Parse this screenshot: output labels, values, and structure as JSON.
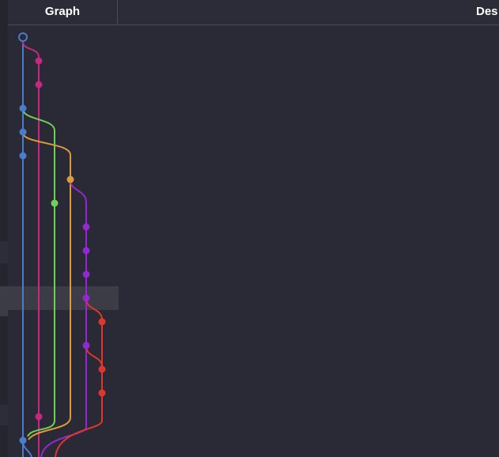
{
  "header": {
    "graph_label": "Graph",
    "description_label": "Des"
  },
  "colors": {
    "background": "#292a35",
    "header_background": "#2b2c37",
    "selection": "#3b3c46",
    "branch_blue": "#4a7cc9",
    "branch_magenta": "#c4287f",
    "branch_green": "#6dd155",
    "branch_orange": "#dc9a3b",
    "branch_purple": "#9029d0",
    "branch_red": "#e0362e"
  },
  "graph": {
    "selected_row_index": 11,
    "branches": [
      "blue",
      "magenta",
      "green",
      "orange",
      "purple",
      "red"
    ]
  }
}
